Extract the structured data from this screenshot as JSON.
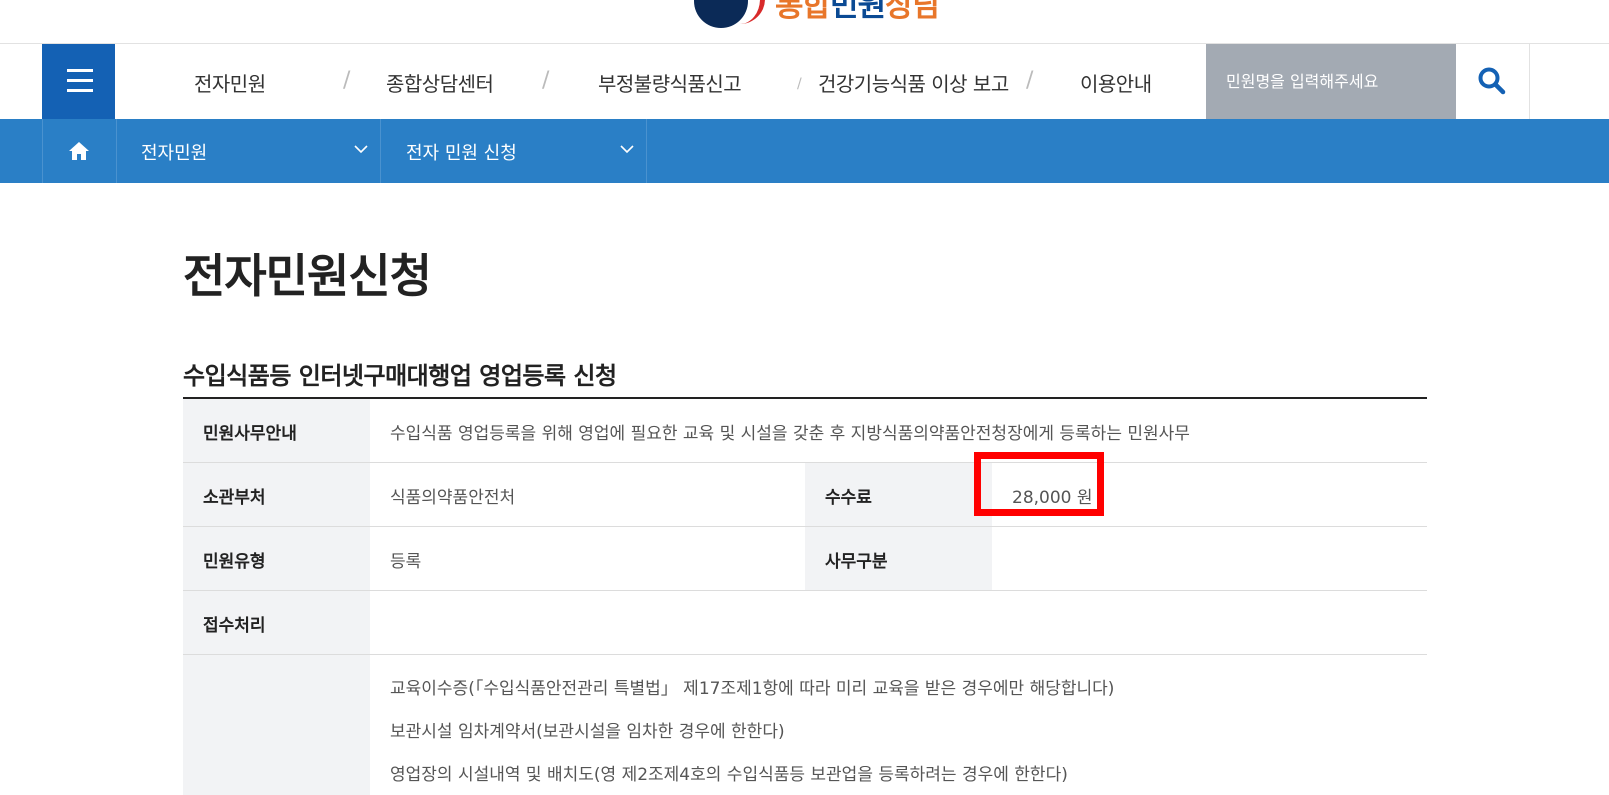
{
  "logo": {
    "text_part1": "통합",
    "text_part2": "민원",
    "text_part3": "상담"
  },
  "gnb": {
    "menu_icon": "hamburger-icon",
    "items": [
      {
        "label": "전자민원"
      },
      {
        "label": "종합상담센터"
      },
      {
        "label": "부정불량식품신고"
      },
      {
        "label": "건강기능식품 이상 보고"
      },
      {
        "label": "이용안내"
      }
    ],
    "search_placeholder": "민원명을 입력해주세요",
    "search_icon": "search-icon"
  },
  "location": {
    "home_icon": "home-icon",
    "level1": "전자민원",
    "level2": "전자 민원 신청"
  },
  "page_title": "전자민원신청",
  "section_title": "수입식품등 인터넷구매대행업 영업등록 신청",
  "table": {
    "guide_label": "민원사무안내",
    "guide_value": "수입식품 영업등록을 위해 영업에 필요한 교육 및 시설을 갖춘 후 지방식품의약품안전청장에게 등록하는 민원사무",
    "dept_label": "소관부처",
    "dept_value": "식품의약품안전처",
    "fee_label": "수수료",
    "fee_value": "28,000 원",
    "type_label": "민원유형",
    "type_value": "등록",
    "category_label": "사무구분",
    "category_value": "",
    "receipt_label": "접수처리",
    "receipt_value": "",
    "documents": [
      "교육이수증(「수입식품안전관리 특별법」 제17조제1항에 따라 미리 교육을 받은 경우에만 해당합니다)",
      "보관시설 임차계약서(보관시설을 임차한 경우에 한한다)",
      "영업장의 시설내역 및 배치도(영 제2조제4호의 수입식품등 보관업을 등록하려는 경우에 한한다)"
    ]
  },
  "colors": {
    "primary": "#1461b4",
    "location_bar": "#2a7fc6",
    "highlight": "#ff0000",
    "search_bg": "#a3aab3"
  }
}
